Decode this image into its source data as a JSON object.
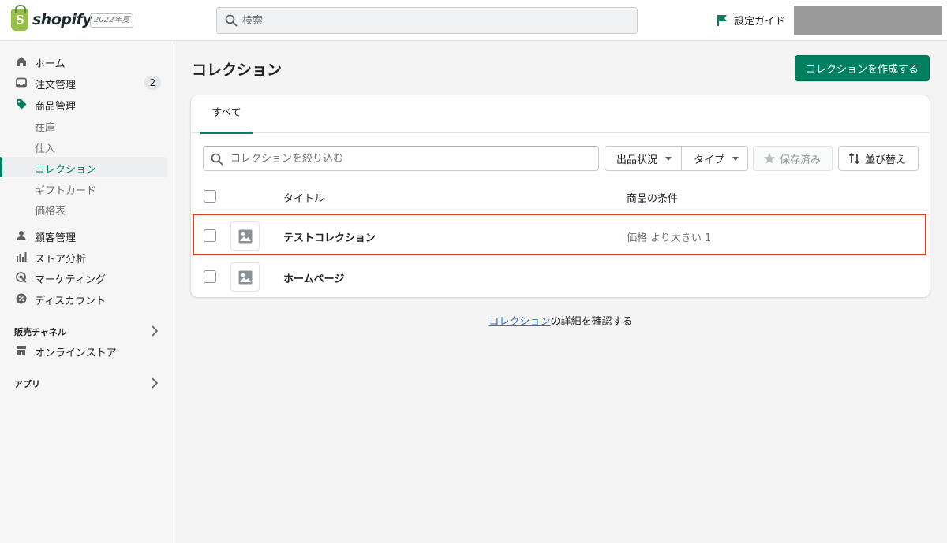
{
  "header": {
    "brand": "shopify",
    "brand_letter": "S",
    "edition": "2022年夏",
    "search_placeholder": "検索",
    "setup_guide": "設定ガイド",
    "accent_color": "#008060"
  },
  "sidebar": {
    "items": [
      {
        "label": "ホーム",
        "icon": "home-icon"
      },
      {
        "label": "注文管理",
        "icon": "orders-icon",
        "badge": "2"
      },
      {
        "label": "商品管理",
        "icon": "tag-icon"
      },
      {
        "label": "在庫",
        "sub": true
      },
      {
        "label": "仕入",
        "sub": true
      },
      {
        "label": "コレクション",
        "sub": true,
        "active": true
      },
      {
        "label": "ギフトカード",
        "sub": true
      },
      {
        "label": "価格表",
        "sub": true
      },
      {
        "label": "顧客管理",
        "icon": "person-icon"
      },
      {
        "label": "ストア分析",
        "icon": "analytics-icon"
      },
      {
        "label": "マーケティング",
        "icon": "target-icon"
      },
      {
        "label": "ディスカウント",
        "icon": "discount-icon"
      }
    ],
    "sales_channels_title": "販売チャネル",
    "online_store": "オンラインストア",
    "apps_title": "アプリ"
  },
  "main": {
    "title": "コレクション",
    "create_button": "コレクションを作成する",
    "tabs": [
      "すべて"
    ],
    "filter_placeholder": "コレクションを絞り込む",
    "status_filter": "出品状況",
    "type_filter": "タイプ",
    "saved_button": "保存済み",
    "sort_button": "並び替え",
    "columns": {
      "title": "タイトル",
      "conditions": "商品の条件"
    },
    "rows": [
      {
        "title": "テストコレクション",
        "conditions": "価格 より大きい 1",
        "highlighted": true
      },
      {
        "title": "ホームページ",
        "conditions": ""
      }
    ],
    "footer_link": "コレクション",
    "footer_text": "の詳細を確認する"
  }
}
